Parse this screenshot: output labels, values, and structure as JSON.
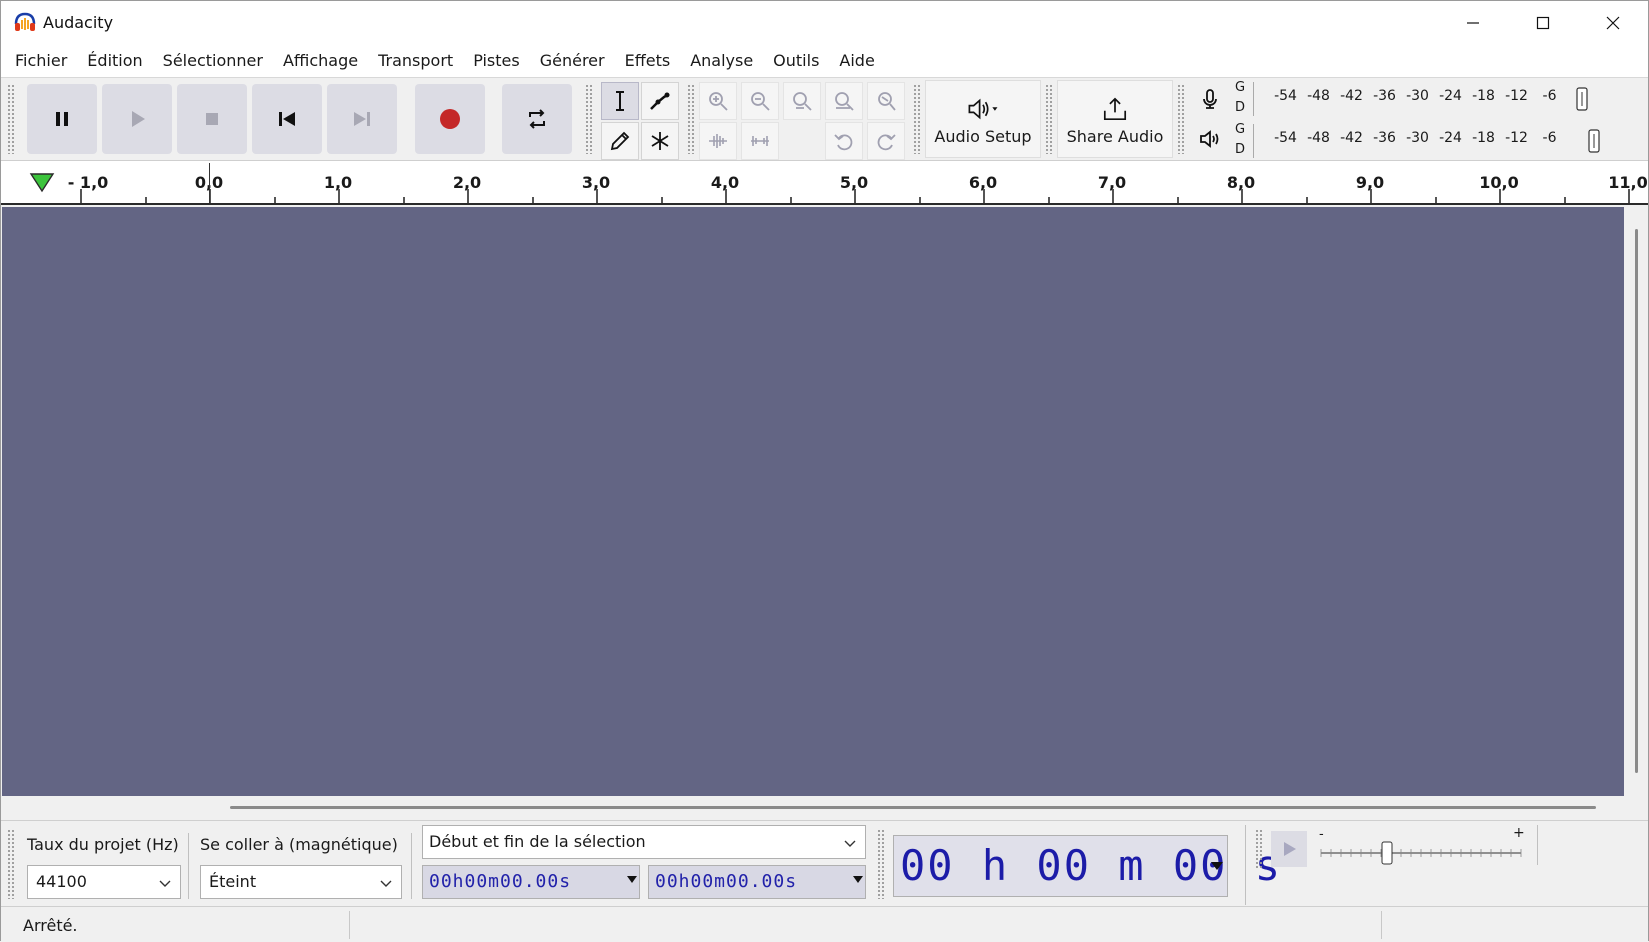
{
  "window": {
    "title": "Audacity"
  },
  "menu": [
    "Fichier",
    "Édition",
    "Sélectionner",
    "Affichage",
    "Transport",
    "Pistes",
    "Générer",
    "Effets",
    "Analyse",
    "Outils",
    "Aide"
  ],
  "toolbar": {
    "audio_setup_label": "Audio Setup",
    "share_audio_label": "Share Audio",
    "record_meter": {
      "left": "G",
      "right": "D"
    },
    "play_meter": {
      "left": "G",
      "right": "D"
    },
    "meter_scale": [
      "-54",
      "-48",
      "-42",
      "-36",
      "-30",
      "-24",
      "-18",
      "-12",
      "-6"
    ]
  },
  "ruler": {
    "labels": [
      "- 1,0",
      "0,0",
      "1,0",
      "2,0",
      "3,0",
      "4,0",
      "5,0",
      "6,0",
      "7,0",
      "8,0",
      "9,0",
      "10,0",
      "11,0"
    ]
  },
  "selection_bar": {
    "rate_label": "Taux du projet (Hz)",
    "rate_value": "44100",
    "snap_label": "Se coller à (magnétique)",
    "snap_value": "Éteint",
    "selection_mode": "Début et fin de la sélection",
    "start_time": "00h00m00.00s",
    "end_time": "00h00m00.00s",
    "audio_position": "00 h 00 m 00 s"
  },
  "play_at_speed": {
    "minus": "-",
    "plus": "+",
    "speed": 0.33
  },
  "status": {
    "text": "Arrêté."
  },
  "colors": {
    "track_bg": "#636584",
    "record": "#c42828",
    "time_text": "#1c1ca8"
  }
}
